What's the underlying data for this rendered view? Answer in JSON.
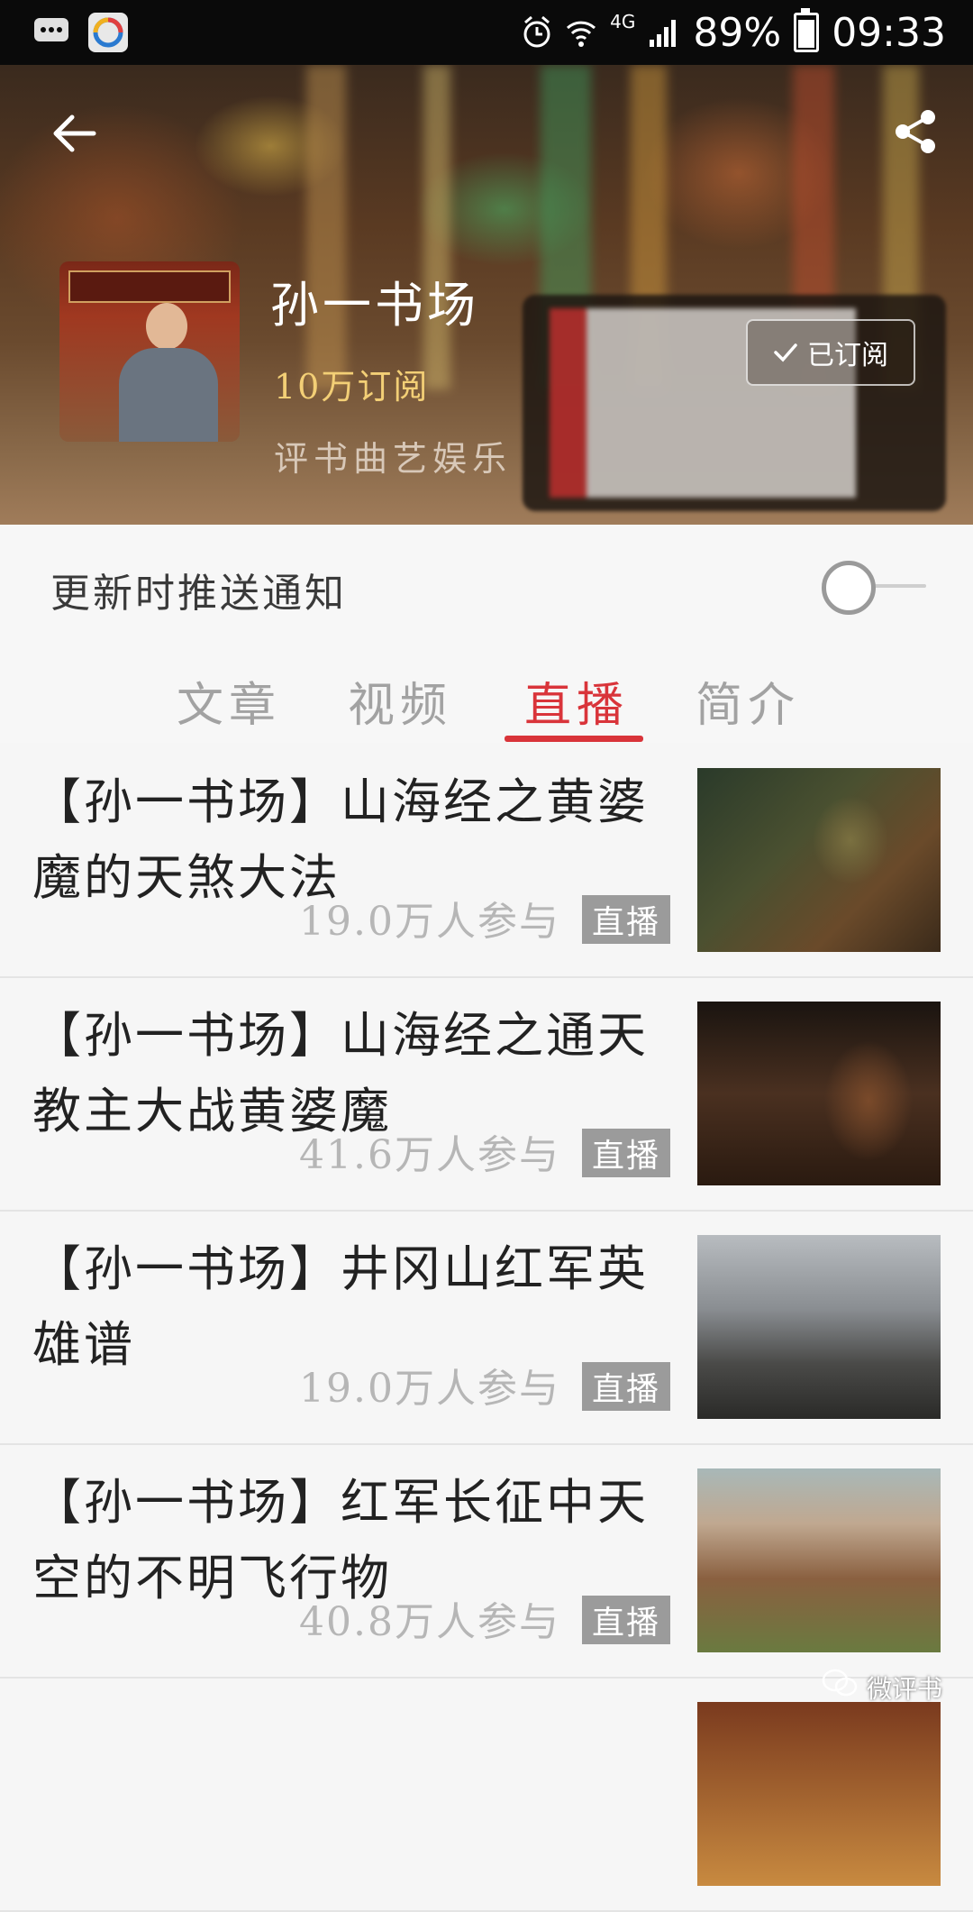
{
  "status_bar": {
    "network": "4G",
    "battery": "89%",
    "time": "09:33",
    "icons": [
      "message-icon",
      "app-icon",
      "alarm-icon",
      "wifi-icon",
      "signal-icon",
      "battery-icon"
    ]
  },
  "header": {
    "channel_title": "孙一书场",
    "subscribers": "10万订阅",
    "category": "评书曲艺娱乐",
    "subscribed_label": "已订阅"
  },
  "push": {
    "label": "更新时推送通知",
    "enabled": false
  },
  "tabs": [
    {
      "label": "文章",
      "active": false
    },
    {
      "label": "视频",
      "active": false
    },
    {
      "label": "直播",
      "active": true
    },
    {
      "label": "简介",
      "active": false
    }
  ],
  "items": [
    {
      "title": "【孙一书场】山海经之黄婆魔的天煞大法",
      "count": "19.0万人参与",
      "badge": "直播"
    },
    {
      "title": "【孙一书场】山海经之通天教主大战黄婆魔",
      "count": "41.6万人参与",
      "badge": "直播"
    },
    {
      "title": "【孙一书场】井冈山红军英雄谱",
      "count": "19.0万人参与",
      "badge": "直播"
    },
    {
      "title": "【孙一书场】红军长征中天空的不明飞行物",
      "count": "40.8万人参与",
      "badge": "直播"
    }
  ],
  "watermark": "微评书",
  "colors": {
    "accent": "#d9343a",
    "subscribers": "#f3cf76",
    "badge": "#9b9b9b"
  }
}
